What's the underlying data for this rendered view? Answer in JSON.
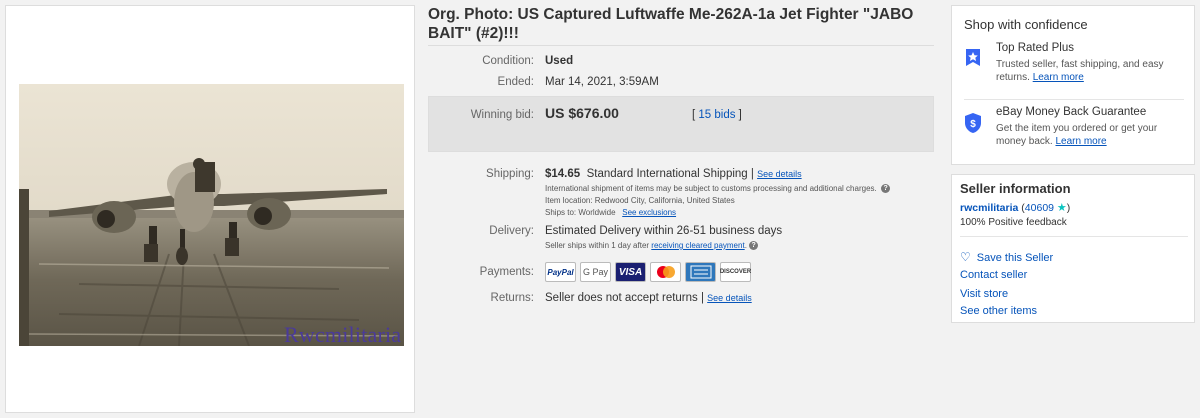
{
  "listing": {
    "title": "Org. Photo: US Captured Luftwaffe Me-262A-1a Jet Fighter \"JABO BAIT\" (#2)!!!",
    "watermark": "Rwcmilitaria",
    "condition_label": "Condition:",
    "condition_value": "Used",
    "ended_label": "Ended:",
    "ended_value": "Mar 14, 2021, 3:59AM",
    "winning_label": "Winning bid:",
    "winning_value": "US $676.00",
    "bids_open": "[ ",
    "bids_link": "15 bids",
    "bids_close": " ]",
    "shipping_label": "Shipping:",
    "shipping_price": "$14.65",
    "shipping_method": "Standard International Shipping |",
    "shipping_details_link": "See details",
    "shipping_note1": "International shipment of items may be subject to customs processing and additional charges.",
    "shipping_note2": "Item location:  Redwood City, California, United States",
    "shipping_note3_prefix": "Ships to:  Worldwide",
    "shipping_exclusions_link": "See exclusions",
    "delivery_label": "Delivery:",
    "delivery_value": "Estimated Delivery within 26-51 business days",
    "delivery_note_prefix": "Seller ships within 1 day after",
    "delivery_note_link": "receiving cleared payment",
    "delivery_note_suffix": ".",
    "payments_label": "Payments:",
    "payments": [
      "PayPal",
      "G Pay",
      "VISA",
      "Mastercard",
      "AMERICAN EXPRESS",
      "DISCOVER"
    ],
    "returns_label": "Returns:",
    "returns_value": "Seller does not accept returns |",
    "returns_link": "See details"
  },
  "confidence": {
    "title": "Shop with confidence",
    "items": [
      {
        "heading": "Top Rated Plus",
        "text": "Trusted seller, fast shipping, and easy returns.",
        "link": "Learn more",
        "icon": "top-rated-icon"
      },
      {
        "heading": "eBay Money Back Guarantee",
        "text": "Get the item you ordered or get your money back.",
        "link": "Learn more",
        "icon": "money-back-shield-icon"
      }
    ]
  },
  "seller": {
    "title": "Seller information",
    "name": "rwcmilitaria",
    "feedback_open": "(",
    "feedback_count": "40609",
    "feedback_close": ")",
    "positive": "100% Positive feedback",
    "save": "Save this Seller",
    "contact": "Contact seller",
    "store": "Visit store",
    "other": "See other items"
  },
  "colors": {
    "link": "#0654ba",
    "star": "#0bc5c0",
    "bidbox": "#e2e2e2"
  }
}
